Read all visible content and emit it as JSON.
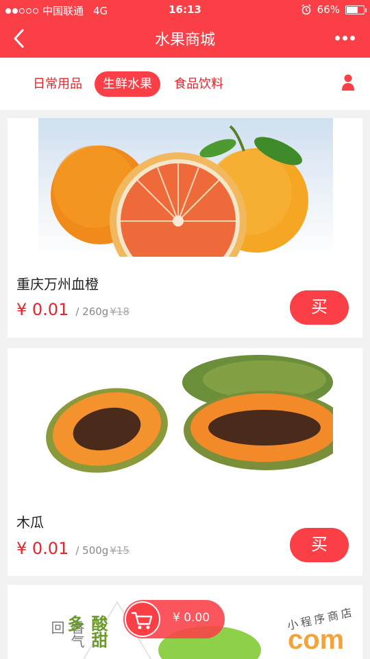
{
  "status": {
    "carrier": "中国联通",
    "network": "4G",
    "time": "16:13",
    "battery_text": "66%",
    "battery_level": 0.66
  },
  "header": {
    "title": "水果商城",
    "back_icon": "chevron-left-icon",
    "more_icon": "more-dots-icon"
  },
  "tabs": {
    "items": [
      {
        "label": "日常用品"
      },
      {
        "label": "生鲜水果",
        "active": true
      },
      {
        "label": "食品饮料"
      }
    ],
    "user_icon": "user-icon"
  },
  "products": [
    {
      "name": "重庆万州血橙",
      "price": "¥ 0.01",
      "unit": "/ 260g",
      "orig": "¥18",
      "buy_label": "买"
    },
    {
      "name": "木瓜",
      "price": "¥ 0.01",
      "unit": "/ 500g",
      "orig": "¥15",
      "buy_label": "买"
    }
  ],
  "third_card": {
    "text_a": "香气",
    "text_b": "酸甜",
    "text_c": "回",
    "text_d": "多"
  },
  "cart": {
    "total": "¥ 0.00",
    "icon": "cart-icon"
  },
  "watermark": {
    "small": "小程序商店",
    "com": "com"
  },
  "colors": {
    "brand": "#fb3f47",
    "price": "#e8232c"
  }
}
